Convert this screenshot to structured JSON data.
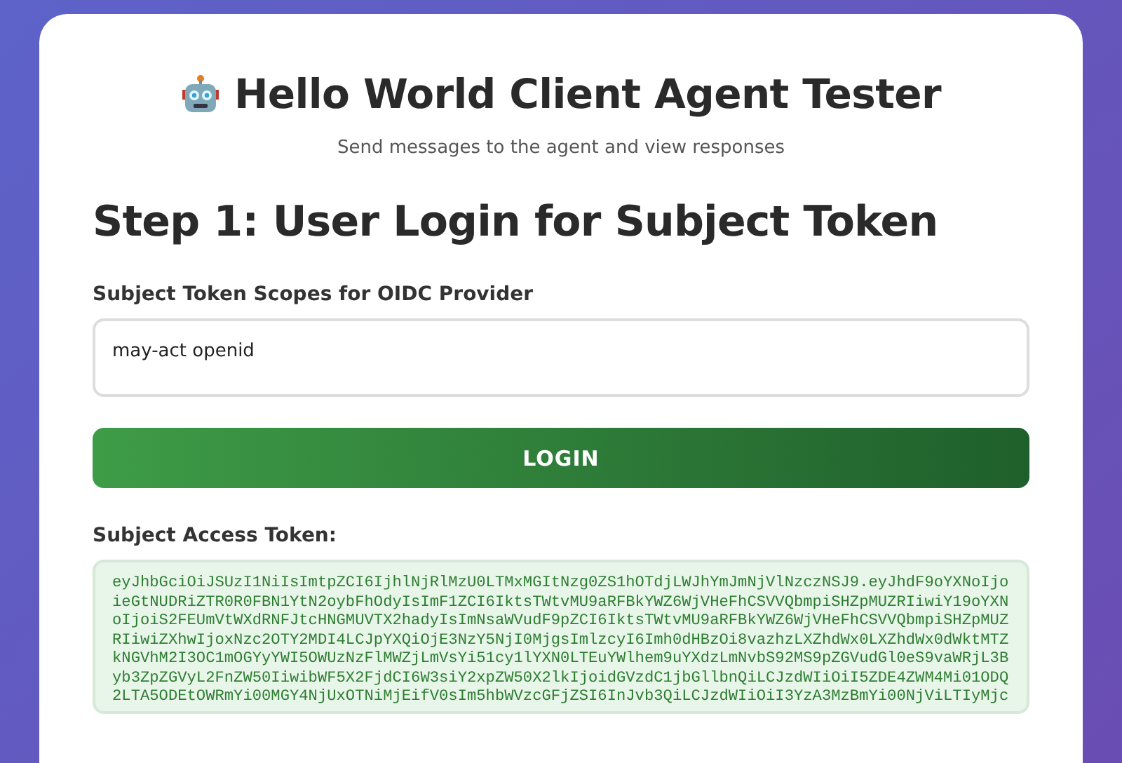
{
  "header": {
    "title": "Hello World Client Agent Tester",
    "subtitle": "Send messages to the agent and view responses"
  },
  "step": {
    "heading": "Step 1: User Login for Subject Token",
    "scopes": {
      "label": "Subject Token Scopes for OIDC Provider",
      "value": "may-act openid"
    },
    "login_button": "LOGIN",
    "token": {
      "label": "Subject Access Token:",
      "lines": [
        "eyJhbGciOiJSUzI1NiIsImtpZCI6IjhlNjRlMzU0LTMxMGItNzg0ZS1hOTdjLWJhYmJmNjVlNzczNSJ9.eyJhdF9oYXNoIjo",
        "ieGtNUDRiZTR0R0FBN1YtN2oybFhOdyIsImF1ZCI6IktsTWtvMU9aRFBkYWZ6WjVHeFhCSVVQbmpiSHZpMUZRIiwiY19oYXN",
        "oIjoiS2FEUmVtWXdRNFJtcHNGMUVTX2hadyIsImNsaWVudF9pZCI6IktsTWtvMU9aRFBkYWZ6WjVHeFhCSVVQbmpiSHZpMUZ",
        "RIiwiZXhwIjoxNzc2OTY2MDI4LCJpYXQiOjE3NzY5NjI0MjgsImlzcyI6Imh0dHBzOi8vazhzLXZhdWx0LXZhdWx0dWktMTZ",
        "kNGVhM2I3OC1mOGYyYWI5OWUzNzFlMWZjLmVsYi51cy1lYXN0LTEuYWlhem9uYXdzLmNvbS92MS9pZGVudGl0eS9vaWRjL3B",
        "yb3ZpZGVyL2FnZW50IiwibWF5X2FjdCI6W3siY2xpZW50X2lkIjoidGVzdC1jbGllbnQiLCJzdWIiOiI5ZDE4ZWM4Mi01ODQ",
        "2LTA5ODEtOWRmYi00MGY4NjUxOTNiMjEifV0sIm5hbWVzcGFjZSI6InJvb3QiLCJzdWIiOiI3YzA3MzBmYi00NjViLTIyMjc"
      ]
    }
  }
}
